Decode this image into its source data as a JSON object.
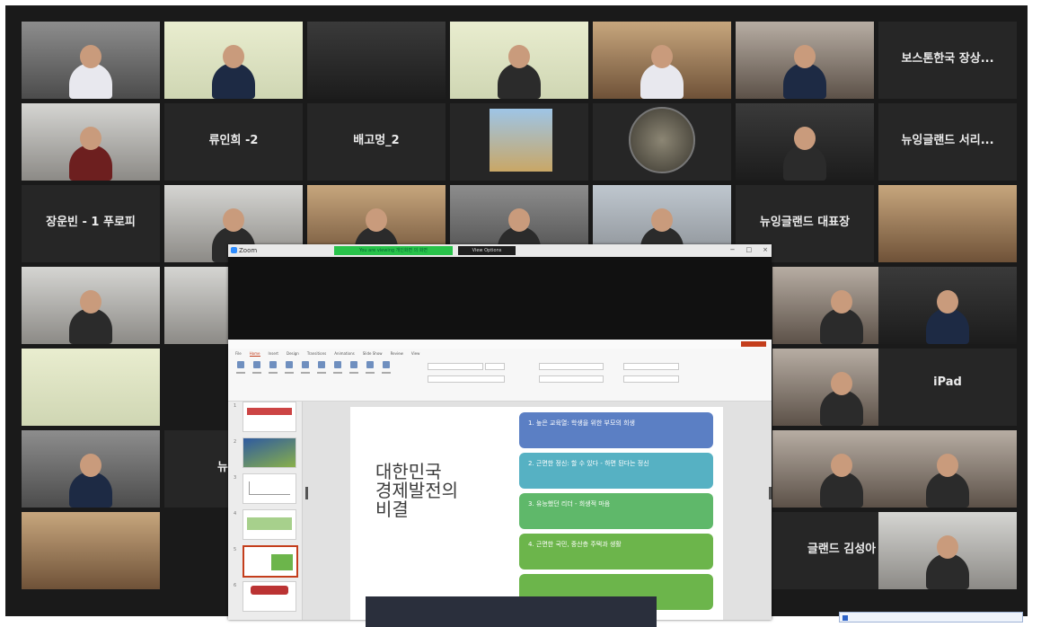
{
  "zoom": {
    "title": "Zoom",
    "share_label": "You are viewing 개인화면 의 화면",
    "view_options": "View Options",
    "window_controls": [
      "−",
      "□",
      "×"
    ]
  },
  "tiles": {
    "t1": "",
    "t2": "",
    "t3": "",
    "t4": "",
    "t5": "",
    "t6": "",
    "t7": "보스톤한국 장상...",
    "t8": "",
    "t9": "류인희 -2",
    "t10": "배고멍_2",
    "t11": "",
    "t12": "",
    "t13": "",
    "t14": "뉴잉글랜드 서리...",
    "t15": "장운빈 - 1 푸로피",
    "t16": "",
    "t17": "",
    "t18": "",
    "t19": "",
    "t20": "뉴잉글랜드 대표장",
    "t21": "",
    "t22": "",
    "t23": "",
    "t24": "",
    "t25": "",
    "t26": "",
    "t27": "",
    "t28": "iPad",
    "t29": "",
    "t30": "뉴잉글",
    "t31": "",
    "t32": "",
    "t33": "",
    "t34": "글랜드 김성아",
    "t35": ""
  },
  "ppt": {
    "doc_title": "",
    "user": "",
    "ribbon_tabs": [
      "File",
      "Home",
      "Insert",
      "Design",
      "Transitions",
      "Animations",
      "Slide Show",
      "Review",
      "View"
    ],
    "slide_numbers": [
      "1",
      "2",
      "3",
      "4",
      "5",
      "6"
    ],
    "slide_title": "대한민국\n경제발전의\n비결",
    "boxes": [
      "1. 높은 교육열: 학생을 위한 부모의 희생",
      "2. 근면한 정신: 할 수 있다 - 하면 된다는 정신",
      "3. 유능했던 리더 - 희생적 마음",
      "4. 근면한 국민, 중산층 주택과 생활",
      ""
    ],
    "box_colors": [
      "#5b7fc4",
      "#56b1c3",
      "#5fb86a",
      "#6cb54b",
      "#6cb54b"
    ]
  },
  "notification": ""
}
